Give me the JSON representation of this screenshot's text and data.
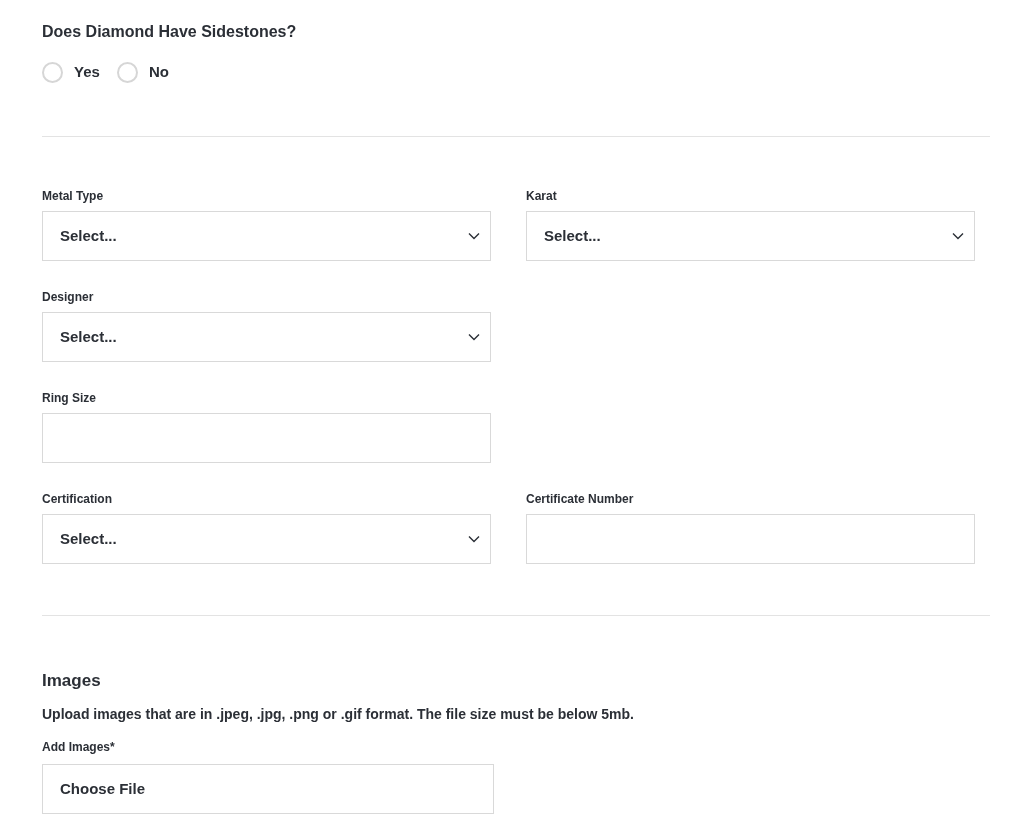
{
  "sidestones": {
    "question": "Does Diamond Have Sidestones?",
    "options": [
      {
        "label": "Yes",
        "selected": false
      },
      {
        "label": "No",
        "selected": false
      }
    ]
  },
  "details": {
    "rows": [
      {
        "fields": [
          {
            "label": "Metal Type",
            "kind": "select",
            "value": "Select..."
          },
          {
            "label": "Karat",
            "kind": "select",
            "value": "Select..."
          }
        ]
      },
      {
        "fields": [
          {
            "label": "Designer",
            "kind": "select",
            "value": "Select..."
          }
        ]
      },
      {
        "fields": [
          {
            "label": "Ring Size",
            "kind": "text"
          }
        ]
      },
      {
        "fields": [
          {
            "label": "Certification",
            "kind": "select",
            "value": "Select..."
          },
          {
            "label": "Certificate Number",
            "kind": "text"
          }
        ]
      }
    ]
  },
  "images": {
    "heading": "Images",
    "description": "Upload images that are in .jpeg, .jpg, .png or .gif format. The file size must be below 5mb.",
    "field_label": "Add Images*",
    "button": "Choose File"
  }
}
